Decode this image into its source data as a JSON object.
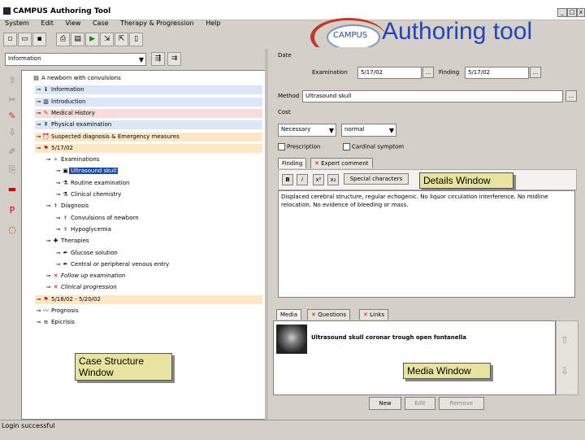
{
  "window": {
    "title": "CAMPUS Authoring Tool"
  },
  "logo": {
    "text": "CAMPUS",
    "title": "Authoring tool"
  },
  "menu": [
    "System",
    "Edit",
    "View",
    "Case",
    "Therapy & Progression",
    "Help"
  ],
  "toolbar": [
    "new-icon",
    "open-icon",
    "save-icon",
    "print-icon",
    "preview-icon",
    "run-icon",
    "export-icon",
    "import-icon",
    "delete-icon"
  ],
  "view_select": {
    "value": "Information"
  },
  "tree": [
    {
      "label": "A newborn with convulsions",
      "level": 0,
      "icon": "case-icon",
      "hl": ""
    },
    {
      "label": "Information",
      "level": 1,
      "icon": "info-icon",
      "hl": "blue"
    },
    {
      "label": "Introduction",
      "level": 1,
      "icon": "book-icon",
      "hl": "blue"
    },
    {
      "label": "Medical History",
      "level": 1,
      "icon": "history-icon",
      "hl": "pink"
    },
    {
      "label": "Physical examination",
      "level": 1,
      "icon": "exam-icon",
      "hl": "blue"
    },
    {
      "label": "Suspected diagnosis & Emergency measures",
      "level": 1,
      "icon": "alarm-icon",
      "hl": "orange"
    },
    {
      "label": "5/17/02",
      "level": 1,
      "icon": "flag-icon",
      "hl": "orange"
    },
    {
      "label": "Examinations",
      "level": 2,
      "icon": "search-icon",
      "hl": ""
    },
    {
      "label": "Ultrasound skull",
      "level": 3,
      "icon": "image-icon",
      "hl": "sel"
    },
    {
      "label": "Routine examination",
      "level": 3,
      "icon": "lab-icon",
      "hl": ""
    },
    {
      "label": "Clinical chemistry",
      "level": 3,
      "icon": "lab-icon",
      "hl": ""
    },
    {
      "label": "Diagnosis",
      "level": 2,
      "icon": "diagnosis-icon",
      "hl": ""
    },
    {
      "label": "Convulsions of newborn",
      "level": 3,
      "icon": "diagnosis-icon",
      "hl": ""
    },
    {
      "label": "Hypoglycemia",
      "level": 3,
      "icon": "diagnosis-icon",
      "hl": ""
    },
    {
      "label": "Therapies",
      "level": 2,
      "icon": "therapy-icon",
      "hl": ""
    },
    {
      "label": "Glucose solution",
      "level": 3,
      "icon": "syringe-icon",
      "hl": ""
    },
    {
      "label": "Central or peripheral venous entry",
      "level": 3,
      "icon": "syringe-icon",
      "hl": ""
    },
    {
      "label": "Follow up examination",
      "level": 2,
      "icon": "cross-icon",
      "hl": ""
    },
    {
      "label": "Clinical progression",
      "level": 2,
      "icon": "cross-icon",
      "hl": ""
    },
    {
      "label": "5/18/02 - 5/20/02",
      "level": 1,
      "icon": "flag-icon",
      "hl": "orange"
    },
    {
      "label": "Prognosis",
      "level": 1,
      "icon": "prognosis-icon",
      "hl": ""
    },
    {
      "label": "Epicrisis",
      "level": 1,
      "icon": "doc-icon",
      "hl": ""
    }
  ],
  "callouts": {
    "case_structure": "Case Structure Window",
    "details": "Details Window",
    "media": "Media Window"
  },
  "details": {
    "date_label": "Date",
    "examination_label": "Examination",
    "examination_value": "5/17/02",
    "finding_label": "Finding",
    "finding_value": "5/17/02",
    "browse": "...",
    "method_label": "Method",
    "method_value": "Ultrasound skull",
    "cost_label": "Cost",
    "necessity_value": "Necessary",
    "normal_value": "normal",
    "prescription_label": "Prescription",
    "cardinal_label": "Cardinal symptom",
    "tabs": [
      "Finding",
      "Expert comment"
    ],
    "format_bold": "B",
    "format_italic": "i",
    "special_chars": "Special characters",
    "finding_text": "Displaced cerebral structure, regular echogenic. No liquor circulation interference. No midline relocation. No evidence of bleeding or mass."
  },
  "media": {
    "tabs": [
      "Media",
      "Questions",
      "Links"
    ],
    "item_caption": "Ultrasound skull coronar trough open fontanella",
    "buttons": {
      "new": "New",
      "edit": "Edit",
      "remove": "Remove"
    }
  },
  "status": {
    "text": "Login successful"
  }
}
